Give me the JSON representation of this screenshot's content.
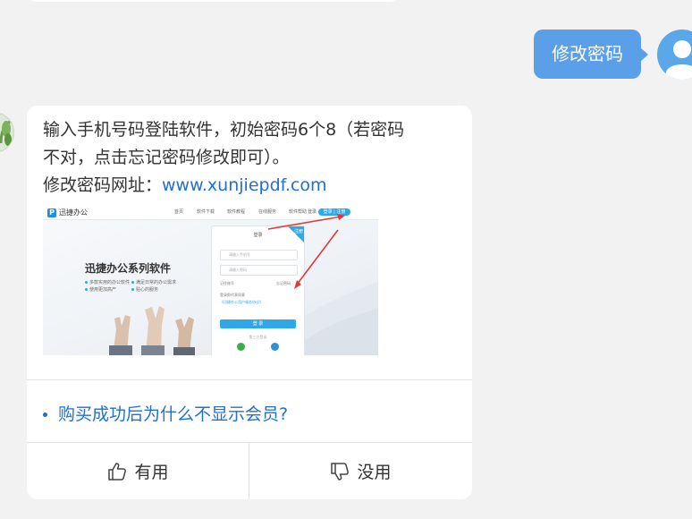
{
  "user_message": "修改密码",
  "bot_reply": {
    "line1": "输入手机号码登陆软件，初始密码6个8（若密码",
    "line2": "不对，点击忘记密码修改即可）。",
    "line3_prefix": "修改密码网址：",
    "link": "www.xunjiepdf.com"
  },
  "embedded_screenshot": {
    "logo": "迅捷办公",
    "logo_mark": "P",
    "nav": [
      "首页",
      "软件下载",
      "软件教程",
      "在线服务",
      "软件帮助",
      "登录"
    ],
    "nav_button": "登录 | 注册",
    "headline": "迅捷办公系列软件",
    "features": [
      "多款实用的办公软件",
      "满足日常的办公需求",
      "使用更加高产",
      "贴心的服务"
    ],
    "panel_title": "登录",
    "panel_corner": "注册",
    "phone_placeholder": "请输入手机号",
    "password_placeholder": "请输入密码",
    "remember": "记住账号",
    "forgot": "忘记密码",
    "agreement_prefix": "登录即代表同意",
    "agreement_link": "《迅捷办公用户服务协议》",
    "submit": "登 录",
    "divider": "第三方登录"
  },
  "related_question": "购买成功后为什么不显示会员?",
  "feedback": {
    "useful": "有用",
    "useless": "没用"
  },
  "colors": {
    "user_bubble": "#5b9fe8",
    "link": "#1f6fd6",
    "accent": "#2fa8e8"
  }
}
